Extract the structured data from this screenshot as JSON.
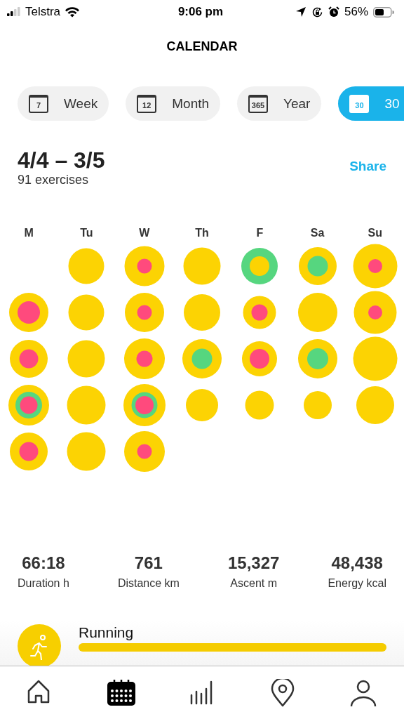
{
  "status_bar": {
    "carrier": "Telstra",
    "time": "9:06 pm",
    "battery": "56%"
  },
  "title": "CALENDAR",
  "tabs": [
    {
      "icon_text": "7",
      "label": "Week",
      "selected": false
    },
    {
      "icon_text": "12",
      "label": "Month",
      "selected": false
    },
    {
      "icon_text": "365",
      "label": "Year",
      "selected": false
    },
    {
      "icon_text": "30",
      "label": "30",
      "selected": true
    }
  ],
  "period": {
    "range": "4/4 – 3/5",
    "count": "91 exercises",
    "share": "Share"
  },
  "weekdays": [
    "M",
    "Tu",
    "W",
    "Th",
    "F",
    "Sa",
    "Su"
  ],
  "days": [
    {
      "kind": "empty"
    },
    {
      "kind": "day",
      "rings": [
        {
          "color": "#fcd303"
        }
      ]
    },
    {
      "kind": "day",
      "rings": [
        {
          "color": "#fcd303"
        },
        {
          "color": "#ff4a7d"
        }
      ]
    },
    {
      "kind": "day",
      "rings": [
        {
          "color": "#fcd303"
        }
      ]
    },
    {
      "kind": "day",
      "rings": [
        {
          "color": "#56d67f"
        },
        {
          "color": "#fcd303"
        }
      ]
    },
    {
      "kind": "day",
      "rings": [
        {
          "color": "#fcd303"
        },
        {
          "color": "#56d67f"
        }
      ]
    },
    {
      "kind": "day",
      "rings": [
        {
          "color": "#fcd303"
        },
        {
          "color": "#ff4a7d"
        }
      ]
    },
    {
      "kind": "day",
      "rings": [
        {
          "color": "#fcd303"
        },
        {
          "color": "#ff4a7d"
        }
      ]
    },
    {
      "kind": "day",
      "rings": [
        {
          "color": "#fcd303"
        }
      ]
    },
    {
      "kind": "day",
      "rings": [
        {
          "color": "#fcd303"
        },
        {
          "color": "#ff4a7d"
        }
      ]
    },
    {
      "kind": "day",
      "rings": [
        {
          "color": "#fcd303"
        }
      ]
    },
    {
      "kind": "day",
      "rings": [
        {
          "color": "#fcd303"
        },
        {
          "color": "#ff4a7d"
        }
      ]
    },
    {
      "kind": "day",
      "rings": [
        {
          "color": "#fcd303"
        }
      ]
    },
    {
      "kind": "day",
      "rings": [
        {
          "color": "#fcd303"
        },
        {
          "color": "#ff4a7d"
        }
      ]
    },
    {
      "kind": "day",
      "rings": [
        {
          "color": "#fcd303"
        },
        {
          "color": "#ff4a7d"
        }
      ]
    },
    {
      "kind": "day",
      "rings": [
        {
          "color": "#fcd303"
        }
      ]
    },
    {
      "kind": "day",
      "rings": [
        {
          "color": "#fcd303"
        },
        {
          "color": "#ff4a7d"
        }
      ]
    },
    {
      "kind": "day",
      "rings": [
        {
          "color": "#fcd303"
        },
        {
          "color": "#56d67f"
        }
      ]
    },
    {
      "kind": "day",
      "rings": [
        {
          "color": "#fcd303"
        },
        {
          "color": "#ff4a7d"
        }
      ]
    },
    {
      "kind": "day",
      "rings": [
        {
          "color": "#fcd303"
        },
        {
          "color": "#56d67f"
        }
      ]
    },
    {
      "kind": "day",
      "rings": [
        {
          "color": "#fcd303"
        }
      ]
    },
    {
      "kind": "day",
      "rings": [
        {
          "color": "#fcd303"
        },
        {
          "color": "#56d67f"
        },
        {
          "color": "#ff4a7d"
        }
      ]
    },
    {
      "kind": "day",
      "rings": [
        {
          "color": "#fcd303"
        }
      ]
    },
    {
      "kind": "day",
      "rings": [
        {
          "color": "#fcd303"
        },
        {
          "color": "#56d67f"
        },
        {
          "color": "#ff4a7d"
        }
      ]
    },
    {
      "kind": "day",
      "rings": [
        {
          "color": "#fcd303"
        }
      ]
    },
    {
      "kind": "day",
      "rings": [
        {
          "color": "#fcd303"
        }
      ]
    },
    {
      "kind": "day",
      "rings": [
        {
          "color": "#fcd303"
        }
      ]
    },
    {
      "kind": "day",
      "rings": [
        {
          "color": "#fcd303"
        }
      ]
    },
    {
      "kind": "day",
      "rings": [
        {
          "color": "#fcd303"
        },
        {
          "color": "#ff4a7d"
        }
      ]
    },
    {
      "kind": "day",
      "rings": [
        {
          "color": "#fcd303"
        }
      ]
    },
    {
      "kind": "day",
      "rings": [
        {
          "color": "#fcd303"
        },
        {
          "color": "#ff4a7d"
        }
      ]
    }
  ],
  "stats": [
    {
      "value": "66:18",
      "label": "Duration h"
    },
    {
      "value": "761",
      "label": "Distance km"
    },
    {
      "value": "15,327",
      "label": "Ascent m"
    },
    {
      "value": "48,438",
      "label": "Energy kcal"
    }
  ],
  "activities": [
    {
      "name": "Running",
      "level": 1.0
    }
  ],
  "nav": [
    {
      "kind": "home",
      "selected": false
    },
    {
      "kind": "calendar",
      "selected": true
    },
    {
      "kind": "stats",
      "selected": false
    },
    {
      "kind": "map",
      "selected": false
    },
    {
      "kind": "profile",
      "selected": false
    }
  ]
}
